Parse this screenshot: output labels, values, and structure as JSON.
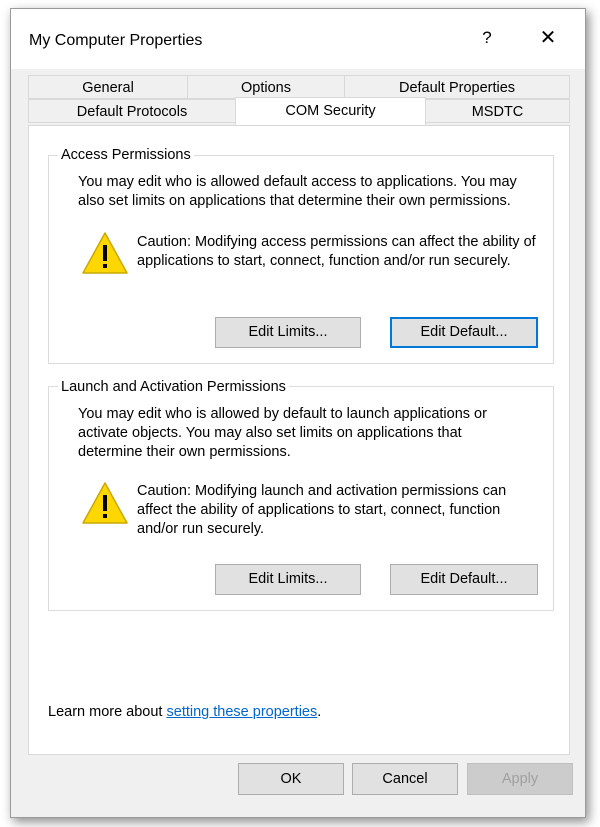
{
  "window": {
    "title": "My Computer Properties",
    "help_glyph": "?",
    "close_glyph": "✕"
  },
  "tabs": {
    "row_top": [
      "General",
      "Options",
      "Default Properties"
    ],
    "row_bottom": [
      "Default Protocols",
      "COM Security",
      "MSDTC"
    ],
    "active": "COM Security"
  },
  "access": {
    "title": "Access Permissions",
    "description": "You may edit who is allowed default access to applications. You may also set limits on applications that determine their own permissions.",
    "caution": "Caution: Modifying access permissions can affect the ability of applications to start, connect, function and/or run securely.",
    "edit_limits": "Edit Limits...",
    "edit_default": "Edit Default..."
  },
  "launch": {
    "title": "Launch and Activation Permissions",
    "description": "You may edit who is allowed by default to launch applications or activate objects. You may also set limits on applications that determine their own permissions.",
    "caution": "Caution: Modifying launch and activation permissions can affect the ability of applications to start, connect, function and/or run securely.",
    "edit_limits": "Edit Limits...",
    "edit_default": "Edit Default..."
  },
  "learn_more": {
    "prefix": "Learn more about ",
    "link": "setting these properties",
    "suffix": "."
  },
  "footer": {
    "ok": "OK",
    "cancel": "Cancel",
    "apply": "Apply"
  },
  "colors": {
    "warning_fill": "#ffd700",
    "link": "#0066cc",
    "focus_border": "#0078d7"
  }
}
